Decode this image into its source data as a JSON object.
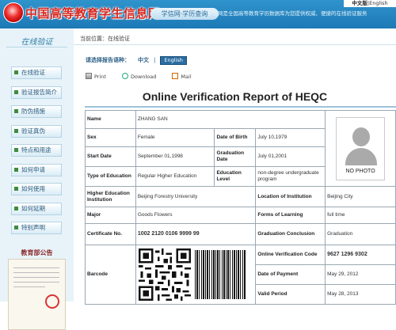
{
  "header": {
    "site_name": "中国高等教育学生信息网",
    "site_button": "学信网·学历查询",
    "slogan": "学信网是全国高等教育学历数据库为您提供权威、便捷的在线验证服务",
    "lang_zh": "中文版",
    "lang_sep": "|",
    "lang_en": "English"
  },
  "sidebar": {
    "title": "在线验证",
    "items": [
      {
        "label": "在线验证"
      },
      {
        "label": "验证报告简介"
      },
      {
        "label": "防伪措施"
      },
      {
        "label": "验证真伪"
      },
      {
        "label": "特点和用途"
      },
      {
        "label": "如何申请"
      },
      {
        "label": "如何使用"
      },
      {
        "label": "如何延期"
      },
      {
        "label": "特别声明"
      }
    ],
    "notice_title": "教育部公告"
  },
  "main": {
    "breadcrumb": "当前位置：在线验证",
    "language_prompt": "请选择报告语种：",
    "lang_zh": "中文",
    "lang_sep": "|",
    "lang_en": "English",
    "actions": {
      "print": "Print",
      "download": "Download",
      "mail": "Mail"
    },
    "report_title": "Online Verification Report of HEQC"
  },
  "report": {
    "name_label": "Name",
    "name": "ZHANG SAN",
    "sex_label": "Sex",
    "sex": "Female",
    "dob_label": "Date of Birth",
    "dob": "July 10,1979",
    "start_label": "Start Date",
    "start": "September 01,1998",
    "grad_label": "Graduation Date",
    "grad": "July 01,2001",
    "type_label": "Type of Education",
    "type": "Regular Higher Education",
    "level_label": "Education Level",
    "level": "non-degree undergraduate program",
    "inst_label": "Higher Education Institution",
    "inst": "Beijing Forestry University",
    "loc_label": "Location of Institution",
    "loc": "Beijing City",
    "major_label": "Major",
    "major": "Goods Flowers",
    "forms_label": "Forms of Learning",
    "forms": "full time",
    "cert_label": "Certificate No.",
    "cert": "1002 2120 0106 9999 99",
    "conclusion_label": "Graduation Conclusion",
    "conclusion": "Graduation",
    "barcode_label": "Barcode",
    "code_label": "Online Verification Code",
    "code": "9627 1296 9302",
    "payment_label": "Date of Payment",
    "payment": "May 29, 2012",
    "valid_label": "Valid Period",
    "valid": "May 28, 2013",
    "no_photo": "NO PHOTO"
  },
  "colors": {
    "header_blue": "#1d79b6",
    "accent_red": "#d7271f",
    "sidebar_bg": "#e8f3f9"
  }
}
